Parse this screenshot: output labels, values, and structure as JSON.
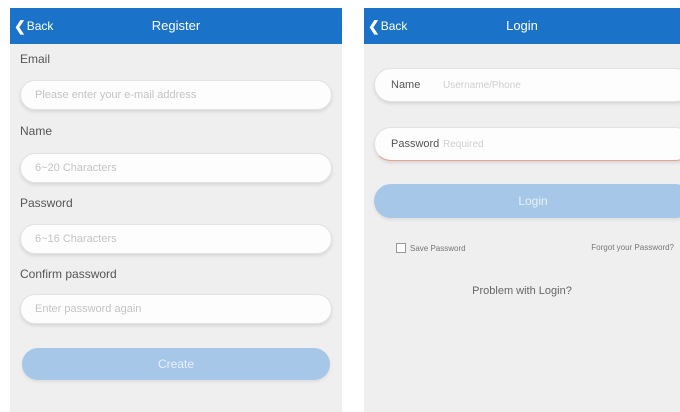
{
  "register": {
    "back_label": "Back",
    "title": "Register",
    "fields": [
      {
        "label": "Email",
        "placeholder": "Please enter your e-mail address"
      },
      {
        "label": "Name",
        "placeholder": "6~20 Characters"
      },
      {
        "label": "Password",
        "placeholder": "6~16 Characters"
      },
      {
        "label": "Confirm password",
        "placeholder": "Enter password again"
      }
    ],
    "submit_label": "Create"
  },
  "login": {
    "back_label": "Back",
    "title": "Login",
    "name_label": "Name",
    "name_placeholder": "Username/Phone",
    "password_label": "Password",
    "password_placeholder": "Required",
    "submit_label": "Login",
    "remember_label": "Save Password",
    "forgot_label": "Forgot your Password?",
    "problem_label": "Problem with Login?"
  },
  "colors": {
    "topbar": "#1a73c9",
    "background": "#efefef",
    "button_disabled": "#a6c7e8"
  },
  "icons": {
    "back": "chevron-left-icon",
    "checkbox": "checkbox-icon"
  }
}
